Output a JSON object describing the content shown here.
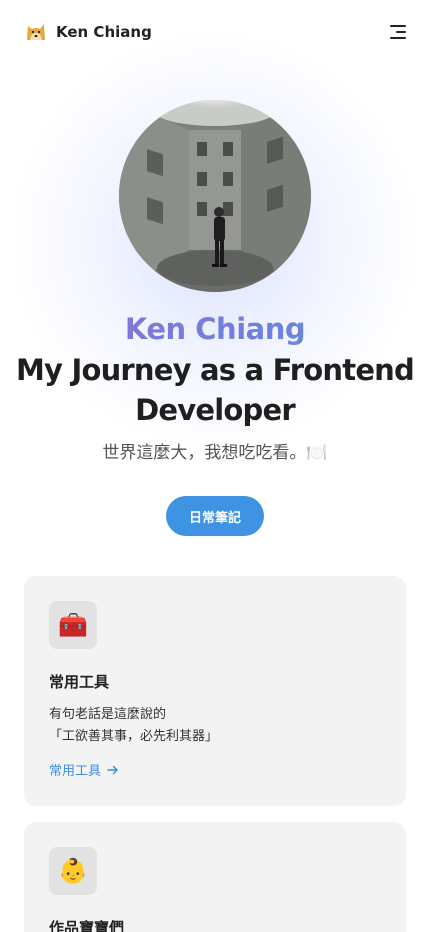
{
  "header": {
    "brand_name": "Ken Chiang",
    "logo_icon": "doge-icon",
    "menu_icon": "hamburger-icon"
  },
  "hero": {
    "name": "Ken Chiang",
    "title": "My Journey as a Frontend Developer",
    "subtitle": "世界這麼大，我想吃吃看。🍽️",
    "cta_label": "日常筆記",
    "colors": {
      "accent": "#3f93e3",
      "name_gradient_start": "#8b6fd8",
      "name_gradient_end": "#5d8ee0"
    }
  },
  "cards": [
    {
      "icon": "toolbox-icon",
      "icon_glyph": "🧰",
      "title": "常用工具",
      "desc_line1": "有句老話是這麼說的",
      "desc_line2": "「工欲善其事，必先利其器」",
      "link_label": "常用工具",
      "link_icon": "arrow-right-icon"
    },
    {
      "icon": "baby-icon",
      "icon_glyph": "👶",
      "title": "作品寶寶們"
    }
  ]
}
